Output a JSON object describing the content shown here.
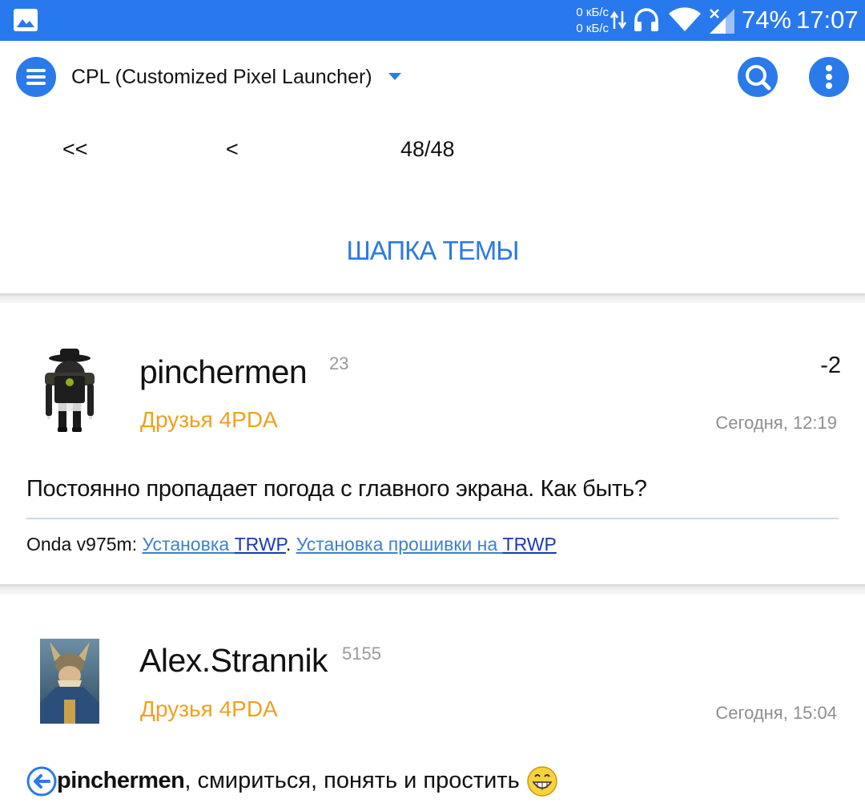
{
  "status_bar": {
    "net_up": "0 кБ/с",
    "net_down": "0 кБ/с",
    "battery": "74%",
    "time": "17:07",
    "icons": [
      "gallery-icon",
      "data-arrows-icon",
      "headphones-icon",
      "wifi-icon",
      "signal-icon"
    ]
  },
  "toolbar": {
    "title": "CPL (Customized Pixel Launcher)",
    "accent": "#2a7ae9"
  },
  "pager": {
    "first": "<<",
    "prev": "<",
    "current": "48/48"
  },
  "topic_header_link": "ШАПКА ТЕМЫ",
  "posts": [
    {
      "username": "pinchermen",
      "reputation": "23",
      "group": "Друзья 4PDA",
      "rating": "-2",
      "date": "Сегодня, 12:19",
      "text": "Постоянно пропадает погода с главного экрана. Как быть?",
      "signature": {
        "prefix": "Onda v975m: ",
        "link1a": "Установка ",
        "link1b": "TRWP",
        "sep": ". ",
        "link2a": "Установка прошивки на ",
        "link2b": "TRWP"
      }
    },
    {
      "username": "Alex.Strannik",
      "reputation": "5155",
      "group": "Друзья 4PDA",
      "date": "Сегодня, 15:04",
      "quote_user": "pinchermen",
      "text": ", смириться, понять и простить "
    }
  ]
}
